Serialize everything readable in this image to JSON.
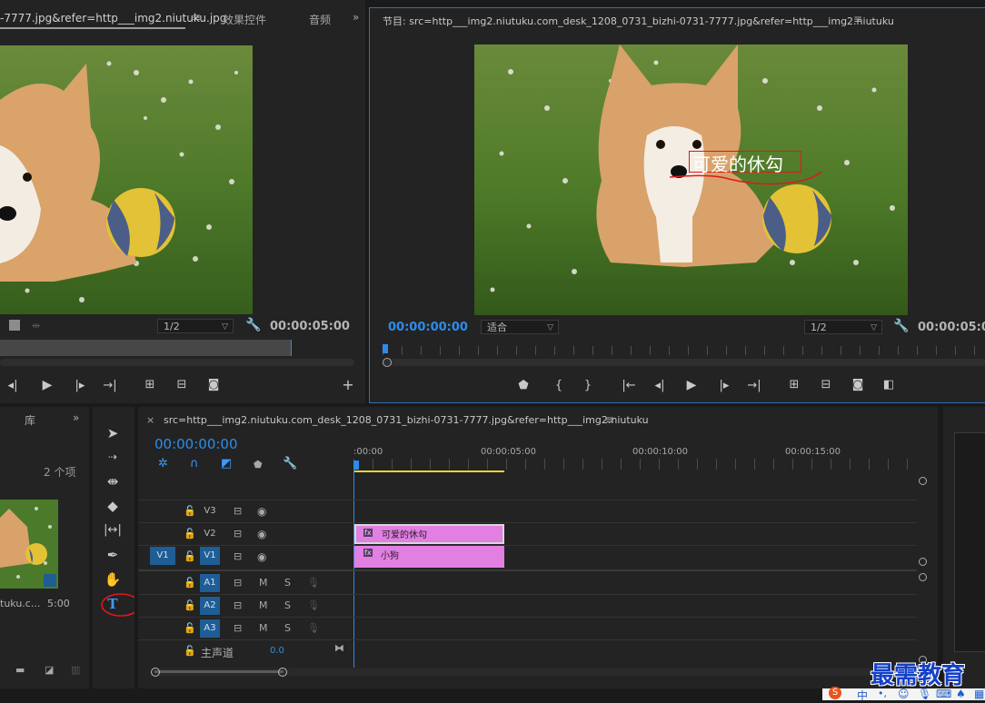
{
  "source_monitor": {
    "tab_title": "-7777.jpg&refer=http___img2.niutuku.jpg",
    "tab_effects": "效果控件",
    "tab_audio": "音频",
    "zoom": "1/2",
    "timecode_end": "00:00:05:00"
  },
  "program_monitor": {
    "title": "节目: src=http___img2.niutuku.com_desk_1208_0731_bizhi-0731-7777.jpg&refer=http___img2.niutuku",
    "timecode": "00:00:00:00",
    "fit": "适合",
    "zoom": "1/2",
    "timecode_end": "00:00:05:00",
    "overlay_title": "可爱的休勾"
  },
  "project_panel": {
    "tab_library": "库",
    "count": "2 个项",
    "item_name": "tuku.c...",
    "item_duration": "5:00"
  },
  "timeline": {
    "sequence_name": "src=http___img2.niutuku.com_desk_1208_0731_bizhi-0731-7777.jpg&refer=http___img2.niutuku",
    "timecode": "00:00:00:00",
    "ruler": [
      ":00:00",
      "00:00:05:00",
      "00:00:10:00",
      "00:00:15:00"
    ],
    "video_tracks": [
      "V3",
      "V2",
      "V1"
    ],
    "source_patch": "V1",
    "audio_tracks": [
      "A1",
      "A2",
      "A3"
    ],
    "mute_label": "M",
    "solo_label": "S",
    "master_label": "主声道",
    "master_value": "0.0",
    "clips": [
      {
        "track": "V2",
        "name": "可爱的休勾",
        "badge": "fx"
      },
      {
        "track": "V1",
        "name": "小狗",
        "badge": "fx"
      }
    ]
  },
  "watermark": "最需教育",
  "taskbar_ime": "中",
  "colors": {
    "accent_blue": "#2d8ceb",
    "clip_pink": "#e27fe2",
    "work_area_yellow": "#e8d432",
    "annotation_red": "#e01818"
  }
}
